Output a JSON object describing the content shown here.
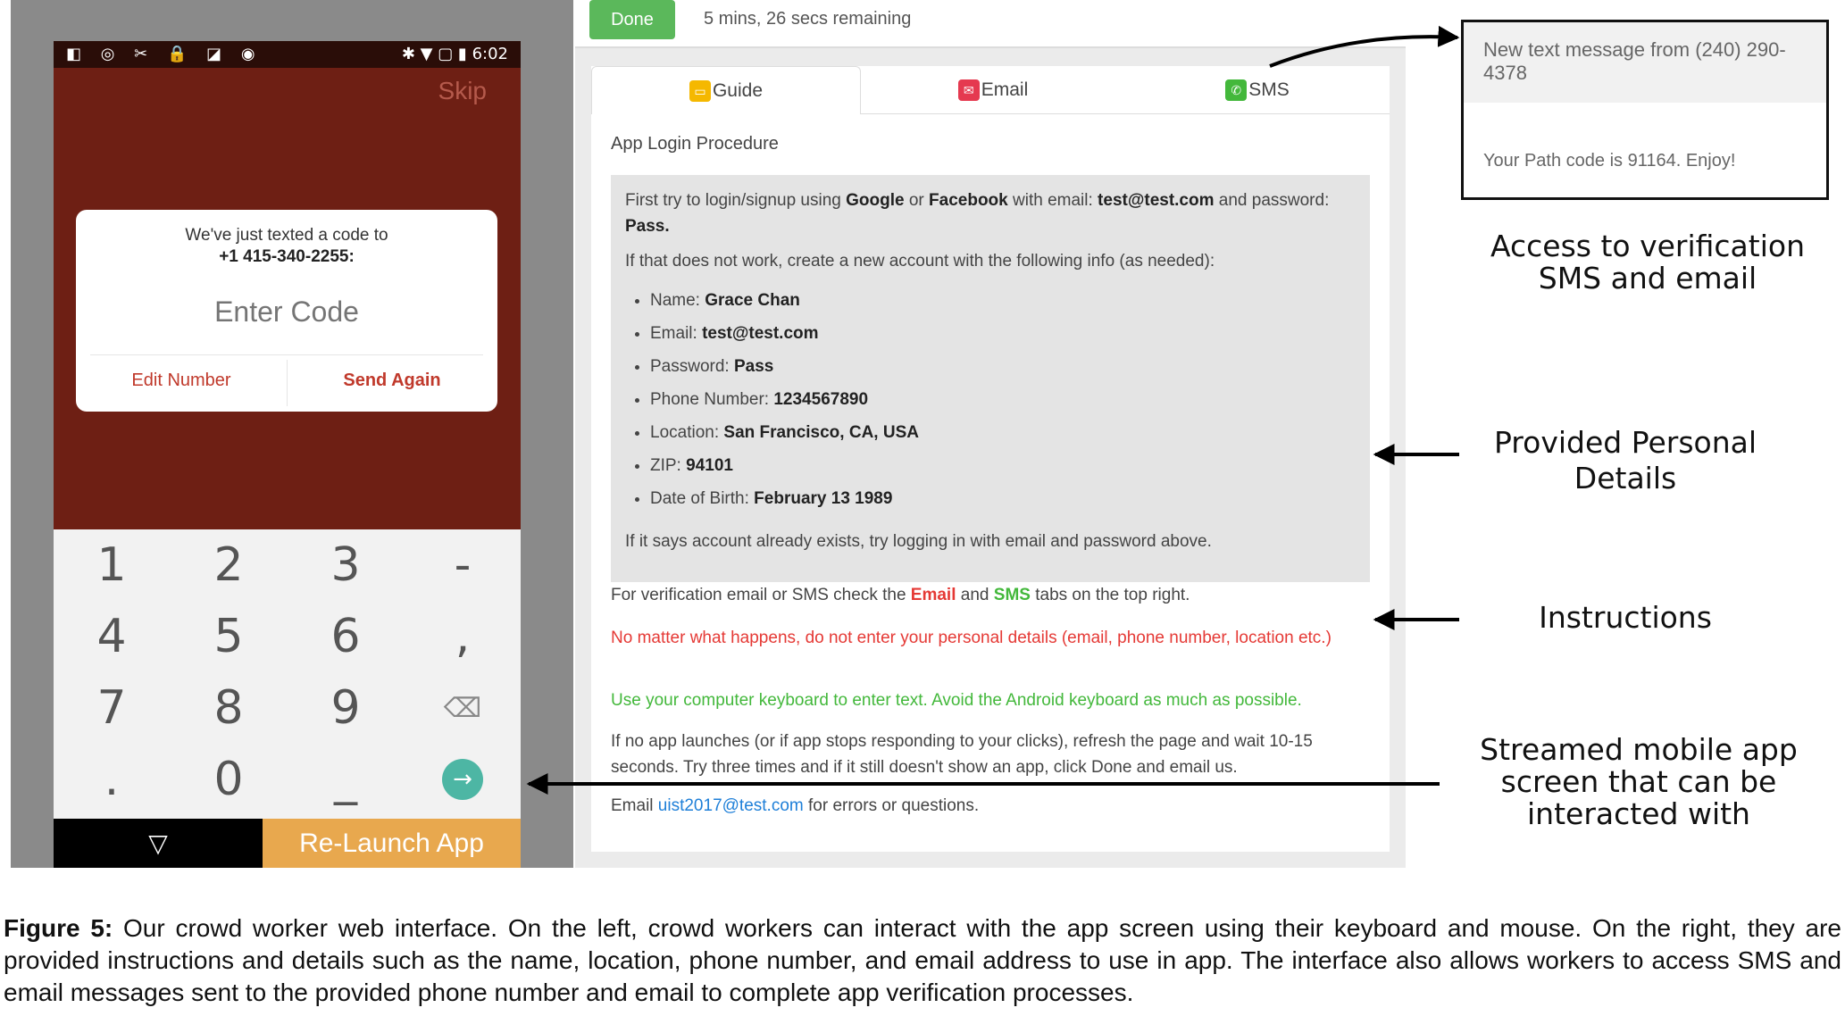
{
  "phone": {
    "status_time": "6:02",
    "status_icons_left": "◧ ◎ ✂ 🔒 ◪ ◉",
    "status_icons_right": "✱ ▼ ▢ ▮",
    "skip_label": "Skip",
    "dialog": {
      "line1": "We've just texted a code to",
      "line2": "+1 415-340-2255:",
      "code_placeholder": "Enter Code",
      "edit_label": "Edit Number",
      "send_label": "Send Again"
    },
    "keypad": {
      "keys": [
        "1",
        "2",
        "3",
        "-",
        "4",
        "5",
        "6",
        ",",
        "7",
        "8",
        "9",
        "⌫",
        ".",
        "0",
        "_",
        "→"
      ]
    },
    "nav_back_icon": "▽",
    "relaunch_label": "Re-Launch App",
    "colors": {
      "app_bg": "#6e1f14",
      "relaunch": "#e8a84e",
      "go_key": "#4db6a4"
    }
  },
  "panel": {
    "done_label": "Done",
    "time_remaining": "5 mins, 26 secs remaining",
    "tabs": [
      {
        "label": "Guide",
        "icon": "guide-icon",
        "color": "#f5b800"
      },
      {
        "label": "Email",
        "icon": "email-icon",
        "color": "#e53950"
      },
      {
        "label": "SMS",
        "icon": "sms-icon",
        "color": "#43b83b"
      }
    ],
    "section_title": "App Login Procedure",
    "intro": {
      "t1": "First try to login/signup using ",
      "google": "Google",
      "t2": " or ",
      "facebook": "Facebook",
      "t3": " with email: ",
      "email": "test@test.com",
      "t4": " and password: ",
      "password": "Pass."
    },
    "fallback": "If that does not work, create a new account with the following info (as needed):",
    "details": [
      {
        "label": "Name: ",
        "value": "Grace Chan"
      },
      {
        "label": "Email: ",
        "value": "test@test.com"
      },
      {
        "label": "Password: ",
        "value": "Pass"
      },
      {
        "label": "Phone Number: ",
        "value": "1234567890"
      },
      {
        "label": "Location: ",
        "value": "San Francisco, CA, USA"
      },
      {
        "label": "ZIP: ",
        "value": "94101"
      },
      {
        "label": "Date of Birth: ",
        "value": "February 13 1989"
      }
    ],
    "exists_note": "If it says account already exists, try logging in with email and password above.",
    "verify": {
      "t1": "For verification email or SMS check the ",
      "email_tab": "Email",
      "t2": " and ",
      "sms_tab": "SMS",
      "t3": " tabs on the top right."
    },
    "warning": "No matter what happens, do not enter your personal details (email, phone number, location etc.)",
    "keyboard_note": "Use your computer keyboard to enter text. Avoid the Android keyboard as much as possible.",
    "refresh_note": "If no app launches (or if app stops responding to your clicks), refresh the page and wait 10-15 seconds. Try three times and if it still doesn't show an app, click Done and email us.",
    "contact": {
      "t1": "Email ",
      "address": "uist2017@test.com",
      "t2": " for errors or questions."
    }
  },
  "sms": {
    "header": "New text message from (240) 290-4378",
    "body": "Your Path code is 91164. Enjoy!"
  },
  "annotations": {
    "access": "Access to verification SMS and email",
    "personal": "Provided Personal Details",
    "instructions": "Instructions",
    "streamed": "Streamed mobile app screen that can be interacted with"
  },
  "caption": {
    "label": "Figure 5:",
    "text": " Our crowd worker web interface. On the left, crowd workers can interact with the app screen using their keyboard and mouse. On the right, they are provided instructions and details such as the name, location, phone number, and email address to use in app. The interface also allows workers to access SMS and email messages sent to the provided phone number and email to complete app verification processes."
  }
}
